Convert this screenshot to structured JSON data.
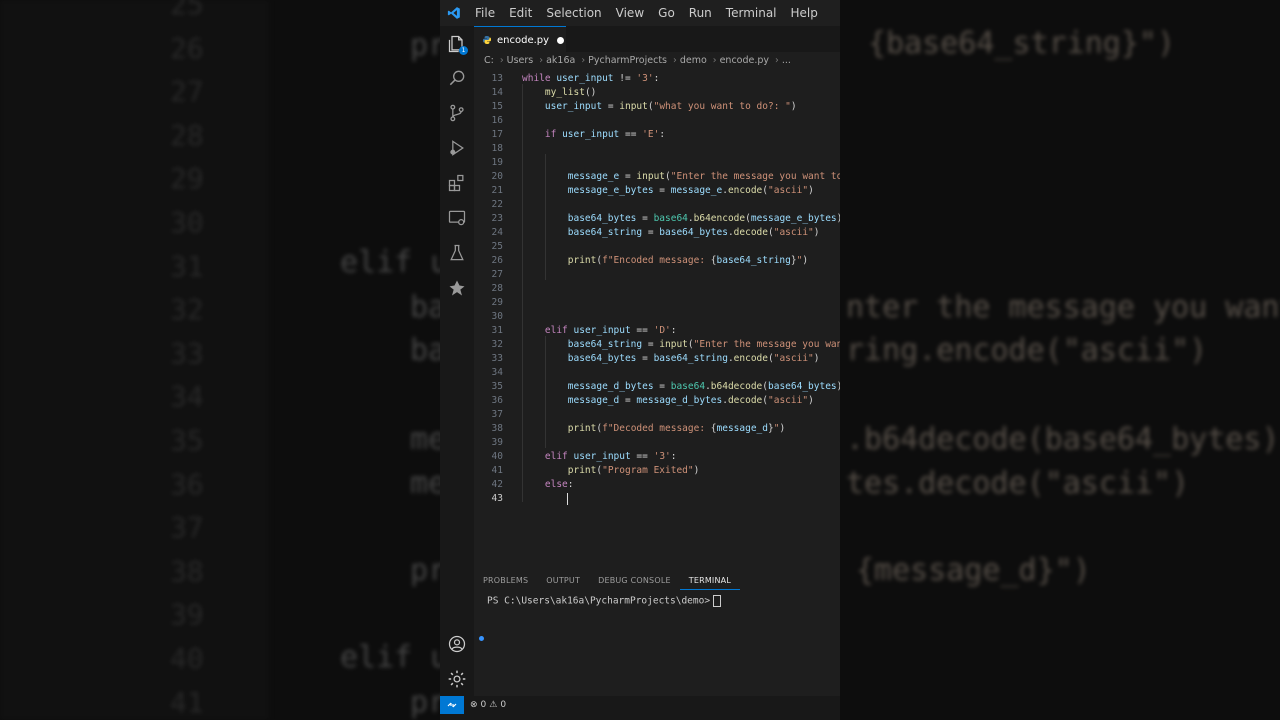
{
  "menu": [
    "File",
    "Edit",
    "Selection",
    "View",
    "Go",
    "Run",
    "Terminal",
    "Help"
  ],
  "tab": {
    "label": "encode.py"
  },
  "breadcrumb": [
    "C:",
    "Users",
    "ak16a",
    "PycharmProjects",
    "demo",
    "encode.py",
    "..."
  ],
  "explorer_badge": "1",
  "code_lines": [
    {
      "n": "13",
      "seg": [
        [
          "kw",
          "while "
        ],
        [
          "var",
          "user_input"
        ],
        [
          "op",
          " != "
        ],
        [
          "str",
          "'3'"
        ],
        [
          "op",
          ":"
        ]
      ]
    },
    {
      "n": "14",
      "seg": [
        [
          "op",
          "    "
        ],
        [
          "fn",
          "my_list"
        ],
        [
          "op",
          "()"
        ]
      ]
    },
    {
      "n": "15",
      "seg": [
        [
          "op",
          "    "
        ],
        [
          "var",
          "user_input"
        ],
        [
          "op",
          " = "
        ],
        [
          "fn",
          "input"
        ],
        [
          "op",
          "("
        ],
        [
          "str",
          "\"what you want to do?: \""
        ],
        [
          "op",
          ")"
        ]
      ]
    },
    {
      "n": "16",
      "seg": []
    },
    {
      "n": "17",
      "seg": [
        [
          "op",
          "    "
        ],
        [
          "kw",
          "if "
        ],
        [
          "var",
          "user_input"
        ],
        [
          "op",
          " == "
        ],
        [
          "str",
          "'E'"
        ],
        [
          "op",
          ":"
        ]
      ]
    },
    {
      "n": "18",
      "seg": []
    },
    {
      "n": "19",
      "seg": []
    },
    {
      "n": "20",
      "seg": [
        [
          "op",
          "        "
        ],
        [
          "var",
          "message_e"
        ],
        [
          "op",
          " = "
        ],
        [
          "fn",
          "input"
        ],
        [
          "op",
          "("
        ],
        [
          "str",
          "\"Enter the message you want to"
        ]
      ]
    },
    {
      "n": "21",
      "seg": [
        [
          "op",
          "        "
        ],
        [
          "var",
          "message_e_bytes"
        ],
        [
          "op",
          " = "
        ],
        [
          "var",
          "message_e"
        ],
        [
          "op",
          "."
        ],
        [
          "fn",
          "encode"
        ],
        [
          "op",
          "("
        ],
        [
          "str",
          "\"ascii\""
        ],
        [
          "op",
          ")"
        ]
      ]
    },
    {
      "n": "22",
      "seg": []
    },
    {
      "n": "23",
      "seg": [
        [
          "op",
          "        "
        ],
        [
          "var",
          "base64_bytes"
        ],
        [
          "op",
          " = "
        ],
        [
          "cls",
          "base64"
        ],
        [
          "op",
          "."
        ],
        [
          "fn",
          "b64encode"
        ],
        [
          "op",
          "("
        ],
        [
          "var",
          "message_e_bytes"
        ],
        [
          "op",
          ")"
        ]
      ]
    },
    {
      "n": "24",
      "seg": [
        [
          "op",
          "        "
        ],
        [
          "var",
          "base64_string"
        ],
        [
          "op",
          " = "
        ],
        [
          "var",
          "base64_bytes"
        ],
        [
          "op",
          "."
        ],
        [
          "fn",
          "decode"
        ],
        [
          "op",
          "("
        ],
        [
          "str",
          "\"ascii\""
        ],
        [
          "op",
          ")"
        ]
      ]
    },
    {
      "n": "25",
      "seg": []
    },
    {
      "n": "26",
      "seg": [
        [
          "op",
          "        "
        ],
        [
          "fn",
          "print"
        ],
        [
          "op",
          "("
        ],
        [
          "str",
          "f\"Encoded message: "
        ],
        [
          "op",
          "{"
        ],
        [
          "var",
          "base64_string"
        ],
        [
          "op",
          "}"
        ],
        [
          "str",
          "\""
        ],
        [
          "op",
          ")"
        ]
      ]
    },
    {
      "n": "27",
      "seg": []
    },
    {
      "n": "28",
      "seg": []
    },
    {
      "n": "29",
      "seg": []
    },
    {
      "n": "30",
      "seg": []
    },
    {
      "n": "31",
      "seg": [
        [
          "op",
          "    "
        ],
        [
          "kw",
          "elif "
        ],
        [
          "var",
          "user_input"
        ],
        [
          "op",
          " == "
        ],
        [
          "str",
          "'D'"
        ],
        [
          "op",
          ":"
        ]
      ]
    },
    {
      "n": "32",
      "seg": [
        [
          "op",
          "        "
        ],
        [
          "var",
          "base64_string"
        ],
        [
          "op",
          " = "
        ],
        [
          "fn",
          "input"
        ],
        [
          "op",
          "("
        ],
        [
          "str",
          "\"Enter the message you want"
        ]
      ]
    },
    {
      "n": "33",
      "seg": [
        [
          "op",
          "        "
        ],
        [
          "var",
          "base64_bytes"
        ],
        [
          "op",
          " = "
        ],
        [
          "var",
          "base64_string"
        ],
        [
          "op",
          "."
        ],
        [
          "fn",
          "encode"
        ],
        [
          "op",
          "("
        ],
        [
          "str",
          "\"ascii\""
        ],
        [
          "op",
          ")"
        ]
      ]
    },
    {
      "n": "34",
      "seg": []
    },
    {
      "n": "35",
      "seg": [
        [
          "op",
          "        "
        ],
        [
          "var",
          "message_d_bytes"
        ],
        [
          "op",
          " = "
        ],
        [
          "cls",
          "base64"
        ],
        [
          "op",
          "."
        ],
        [
          "fn",
          "b64decode"
        ],
        [
          "op",
          "("
        ],
        [
          "var",
          "base64_bytes"
        ],
        [
          "op",
          ")"
        ]
      ]
    },
    {
      "n": "36",
      "seg": [
        [
          "op",
          "        "
        ],
        [
          "var",
          "message_d"
        ],
        [
          "op",
          " = "
        ],
        [
          "var",
          "message_d_bytes"
        ],
        [
          "op",
          "."
        ],
        [
          "fn",
          "decode"
        ],
        [
          "op",
          "("
        ],
        [
          "str",
          "\"ascii\""
        ],
        [
          "op",
          ")"
        ]
      ]
    },
    {
      "n": "37",
      "seg": []
    },
    {
      "n": "38",
      "seg": [
        [
          "op",
          "        "
        ],
        [
          "fn",
          "print"
        ],
        [
          "op",
          "("
        ],
        [
          "str",
          "f\"Decoded message: "
        ],
        [
          "op",
          "{"
        ],
        [
          "var",
          "message_d"
        ],
        [
          "op",
          "}"
        ],
        [
          "str",
          "\""
        ],
        [
          "op",
          ")"
        ]
      ]
    },
    {
      "n": "39",
      "seg": []
    },
    {
      "n": "40",
      "seg": [
        [
          "op",
          "    "
        ],
        [
          "kw",
          "elif "
        ],
        [
          "var",
          "user_input"
        ],
        [
          "op",
          " == "
        ],
        [
          "str",
          "'3'"
        ],
        [
          "op",
          ":"
        ]
      ]
    },
    {
      "n": "41",
      "seg": [
        [
          "op",
          "        "
        ],
        [
          "fn",
          "print"
        ],
        [
          "op",
          "("
        ],
        [
          "str",
          "\"Program Exited\""
        ],
        [
          "op",
          ")"
        ]
      ]
    },
    {
      "n": "42",
      "seg": [
        [
          "op",
          "    "
        ],
        [
          "kw",
          "else"
        ],
        [
          "op",
          ":"
        ]
      ]
    },
    {
      "n": "43",
      "seg": []
    }
  ],
  "panel": {
    "tabs": [
      "PROBLEMS",
      "OUTPUT",
      "DEBUG CONSOLE",
      "TERMINAL"
    ],
    "active": "TERMINAL",
    "prompt": "PS C:\\Users\\ak16a\\PycharmProjects\\demo>"
  },
  "status": {
    "errors": "0",
    "warnings": "0"
  },
  "background_left": {
    "numbers": [
      "25",
      "26",
      "27",
      "28",
      "29",
      "30",
      "31",
      "32",
      "33",
      "34",
      "35",
      "36",
      "37",
      "38",
      "39",
      "40",
      "41"
    ],
    "fragments": [
      "pr",
      "elif u",
      "ba",
      "ba",
      "me",
      "me",
      "pr",
      "elif u",
      "pr"
    ]
  },
  "background_right": {
    "fragments": [
      "{base64_string}\")",
      "nter the message you want",
      "ring.encode(\"ascii\")",
      ".b64decode(base64_bytes)",
      "tes.decode(\"ascii\")",
      "{message_d}\")"
    ]
  },
  "colors": {
    "accent": "#0078d4",
    "keyword": "#c586c0",
    "function": "#dcdcaa",
    "variable": "#9cdcfe",
    "string": "#ce9178"
  }
}
